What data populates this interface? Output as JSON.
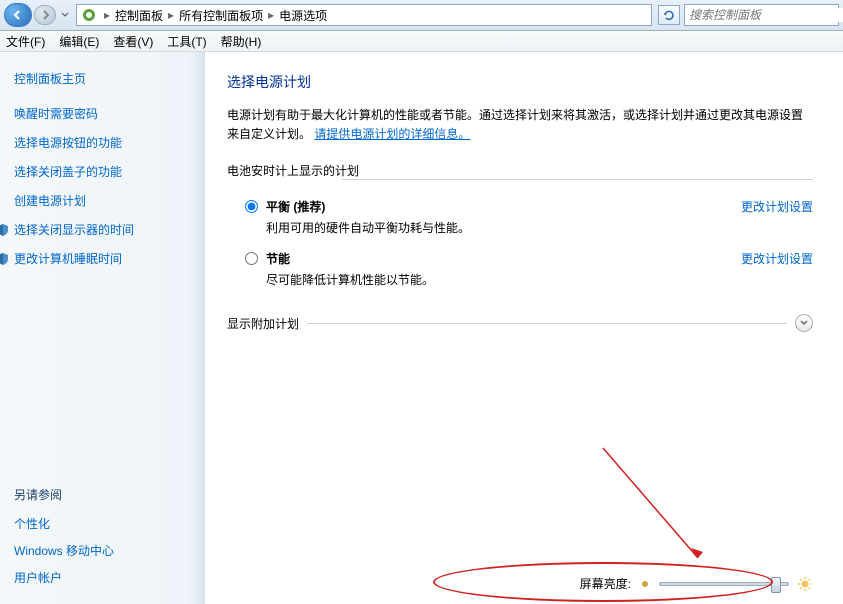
{
  "breadcrumb": {
    "items": [
      "控制面板",
      "所有控制面板项",
      "电源选项"
    ]
  },
  "search": {
    "placeholder": "搜索控制面板"
  },
  "menu": {
    "file": "文件(F)",
    "edit": "编辑(E)",
    "view": "查看(V)",
    "tools": "工具(T)",
    "help": "帮助(H)"
  },
  "sidebar": {
    "home": "控制面板主页",
    "links": [
      "唤醒时需要密码",
      "选择电源按钮的功能",
      "选择关闭盖子的功能",
      "创建电源计划",
      "选择关闭显示器的时间",
      "更改计算机睡眠时间"
    ],
    "see_also_title": "另请参阅",
    "see_also_links": [
      "个性化",
      "Windows 移动中心",
      "用户帐户"
    ]
  },
  "main": {
    "title": "选择电源计划",
    "description_1": "电源计划有助于最大化计算机的性能或者节能。通过选择计划来将其激活，或选择计划并通过更改其电源设置来自定义计划。",
    "more_info_link": "请提供电源计划的详细信息。",
    "plans_legend": "电池安时计上显示的计划",
    "plans": [
      {
        "name": "平衡 (推荐)",
        "description": "利用可用的硬件自动平衡功耗与性能。",
        "selected": true
      },
      {
        "name": "节能",
        "description": "尽可能降低计算机性能以节能。",
        "selected": false
      }
    ],
    "change_plan_label": "更改计划设置",
    "additional_plans_label": "显示附加计划",
    "brightness_label": "屏幕亮度:"
  }
}
